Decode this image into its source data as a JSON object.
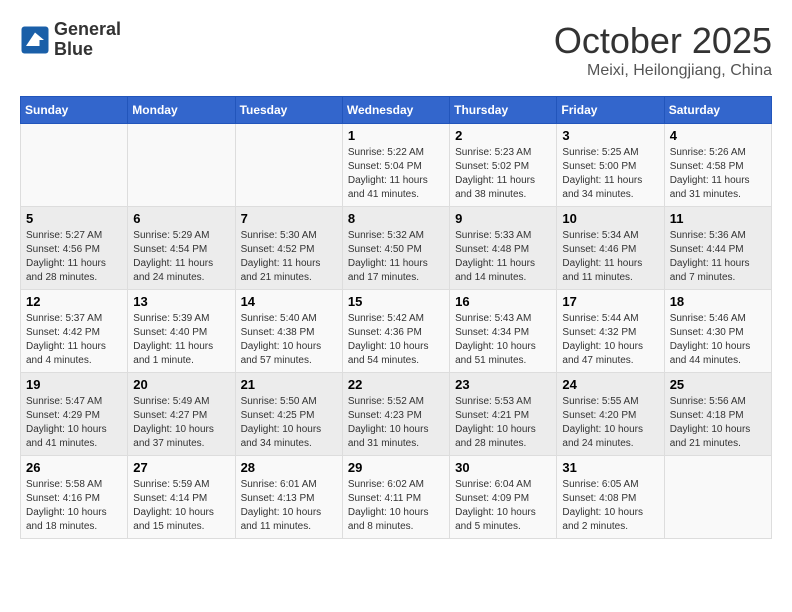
{
  "logo": {
    "line1": "General",
    "line2": "Blue"
  },
  "title": "October 2025",
  "location": "Meixi, Heilongjiang, China",
  "days_of_week": [
    "Sunday",
    "Monday",
    "Tuesday",
    "Wednesday",
    "Thursday",
    "Friday",
    "Saturday"
  ],
  "weeks": [
    [
      {
        "day": "",
        "info": ""
      },
      {
        "day": "",
        "info": ""
      },
      {
        "day": "",
        "info": ""
      },
      {
        "day": "1",
        "info": "Sunrise: 5:22 AM\nSunset: 5:04 PM\nDaylight: 11 hours\nand 41 minutes."
      },
      {
        "day": "2",
        "info": "Sunrise: 5:23 AM\nSunset: 5:02 PM\nDaylight: 11 hours\nand 38 minutes."
      },
      {
        "day": "3",
        "info": "Sunrise: 5:25 AM\nSunset: 5:00 PM\nDaylight: 11 hours\nand 34 minutes."
      },
      {
        "day": "4",
        "info": "Sunrise: 5:26 AM\nSunset: 4:58 PM\nDaylight: 11 hours\nand 31 minutes."
      }
    ],
    [
      {
        "day": "5",
        "info": "Sunrise: 5:27 AM\nSunset: 4:56 PM\nDaylight: 11 hours\nand 28 minutes."
      },
      {
        "day": "6",
        "info": "Sunrise: 5:29 AM\nSunset: 4:54 PM\nDaylight: 11 hours\nand 24 minutes."
      },
      {
        "day": "7",
        "info": "Sunrise: 5:30 AM\nSunset: 4:52 PM\nDaylight: 11 hours\nand 21 minutes."
      },
      {
        "day": "8",
        "info": "Sunrise: 5:32 AM\nSunset: 4:50 PM\nDaylight: 11 hours\nand 17 minutes."
      },
      {
        "day": "9",
        "info": "Sunrise: 5:33 AM\nSunset: 4:48 PM\nDaylight: 11 hours\nand 14 minutes."
      },
      {
        "day": "10",
        "info": "Sunrise: 5:34 AM\nSunset: 4:46 PM\nDaylight: 11 hours\nand 11 minutes."
      },
      {
        "day": "11",
        "info": "Sunrise: 5:36 AM\nSunset: 4:44 PM\nDaylight: 11 hours\nand 7 minutes."
      }
    ],
    [
      {
        "day": "12",
        "info": "Sunrise: 5:37 AM\nSunset: 4:42 PM\nDaylight: 11 hours\nand 4 minutes."
      },
      {
        "day": "13",
        "info": "Sunrise: 5:39 AM\nSunset: 4:40 PM\nDaylight: 11 hours\nand 1 minute."
      },
      {
        "day": "14",
        "info": "Sunrise: 5:40 AM\nSunset: 4:38 PM\nDaylight: 10 hours\nand 57 minutes."
      },
      {
        "day": "15",
        "info": "Sunrise: 5:42 AM\nSunset: 4:36 PM\nDaylight: 10 hours\nand 54 minutes."
      },
      {
        "day": "16",
        "info": "Sunrise: 5:43 AM\nSunset: 4:34 PM\nDaylight: 10 hours\nand 51 minutes."
      },
      {
        "day": "17",
        "info": "Sunrise: 5:44 AM\nSunset: 4:32 PM\nDaylight: 10 hours\nand 47 minutes."
      },
      {
        "day": "18",
        "info": "Sunrise: 5:46 AM\nSunset: 4:30 PM\nDaylight: 10 hours\nand 44 minutes."
      }
    ],
    [
      {
        "day": "19",
        "info": "Sunrise: 5:47 AM\nSunset: 4:29 PM\nDaylight: 10 hours\nand 41 minutes."
      },
      {
        "day": "20",
        "info": "Sunrise: 5:49 AM\nSunset: 4:27 PM\nDaylight: 10 hours\nand 37 minutes."
      },
      {
        "day": "21",
        "info": "Sunrise: 5:50 AM\nSunset: 4:25 PM\nDaylight: 10 hours\nand 34 minutes."
      },
      {
        "day": "22",
        "info": "Sunrise: 5:52 AM\nSunset: 4:23 PM\nDaylight: 10 hours\nand 31 minutes."
      },
      {
        "day": "23",
        "info": "Sunrise: 5:53 AM\nSunset: 4:21 PM\nDaylight: 10 hours\nand 28 minutes."
      },
      {
        "day": "24",
        "info": "Sunrise: 5:55 AM\nSunset: 4:20 PM\nDaylight: 10 hours\nand 24 minutes."
      },
      {
        "day": "25",
        "info": "Sunrise: 5:56 AM\nSunset: 4:18 PM\nDaylight: 10 hours\nand 21 minutes."
      }
    ],
    [
      {
        "day": "26",
        "info": "Sunrise: 5:58 AM\nSunset: 4:16 PM\nDaylight: 10 hours\nand 18 minutes."
      },
      {
        "day": "27",
        "info": "Sunrise: 5:59 AM\nSunset: 4:14 PM\nDaylight: 10 hours\nand 15 minutes."
      },
      {
        "day": "28",
        "info": "Sunrise: 6:01 AM\nSunset: 4:13 PM\nDaylight: 10 hours\nand 11 minutes."
      },
      {
        "day": "29",
        "info": "Sunrise: 6:02 AM\nSunset: 4:11 PM\nDaylight: 10 hours\nand 8 minutes."
      },
      {
        "day": "30",
        "info": "Sunrise: 6:04 AM\nSunset: 4:09 PM\nDaylight: 10 hours\nand 5 minutes."
      },
      {
        "day": "31",
        "info": "Sunrise: 6:05 AM\nSunset: 4:08 PM\nDaylight: 10 hours\nand 2 minutes."
      },
      {
        "day": "",
        "info": ""
      }
    ]
  ]
}
